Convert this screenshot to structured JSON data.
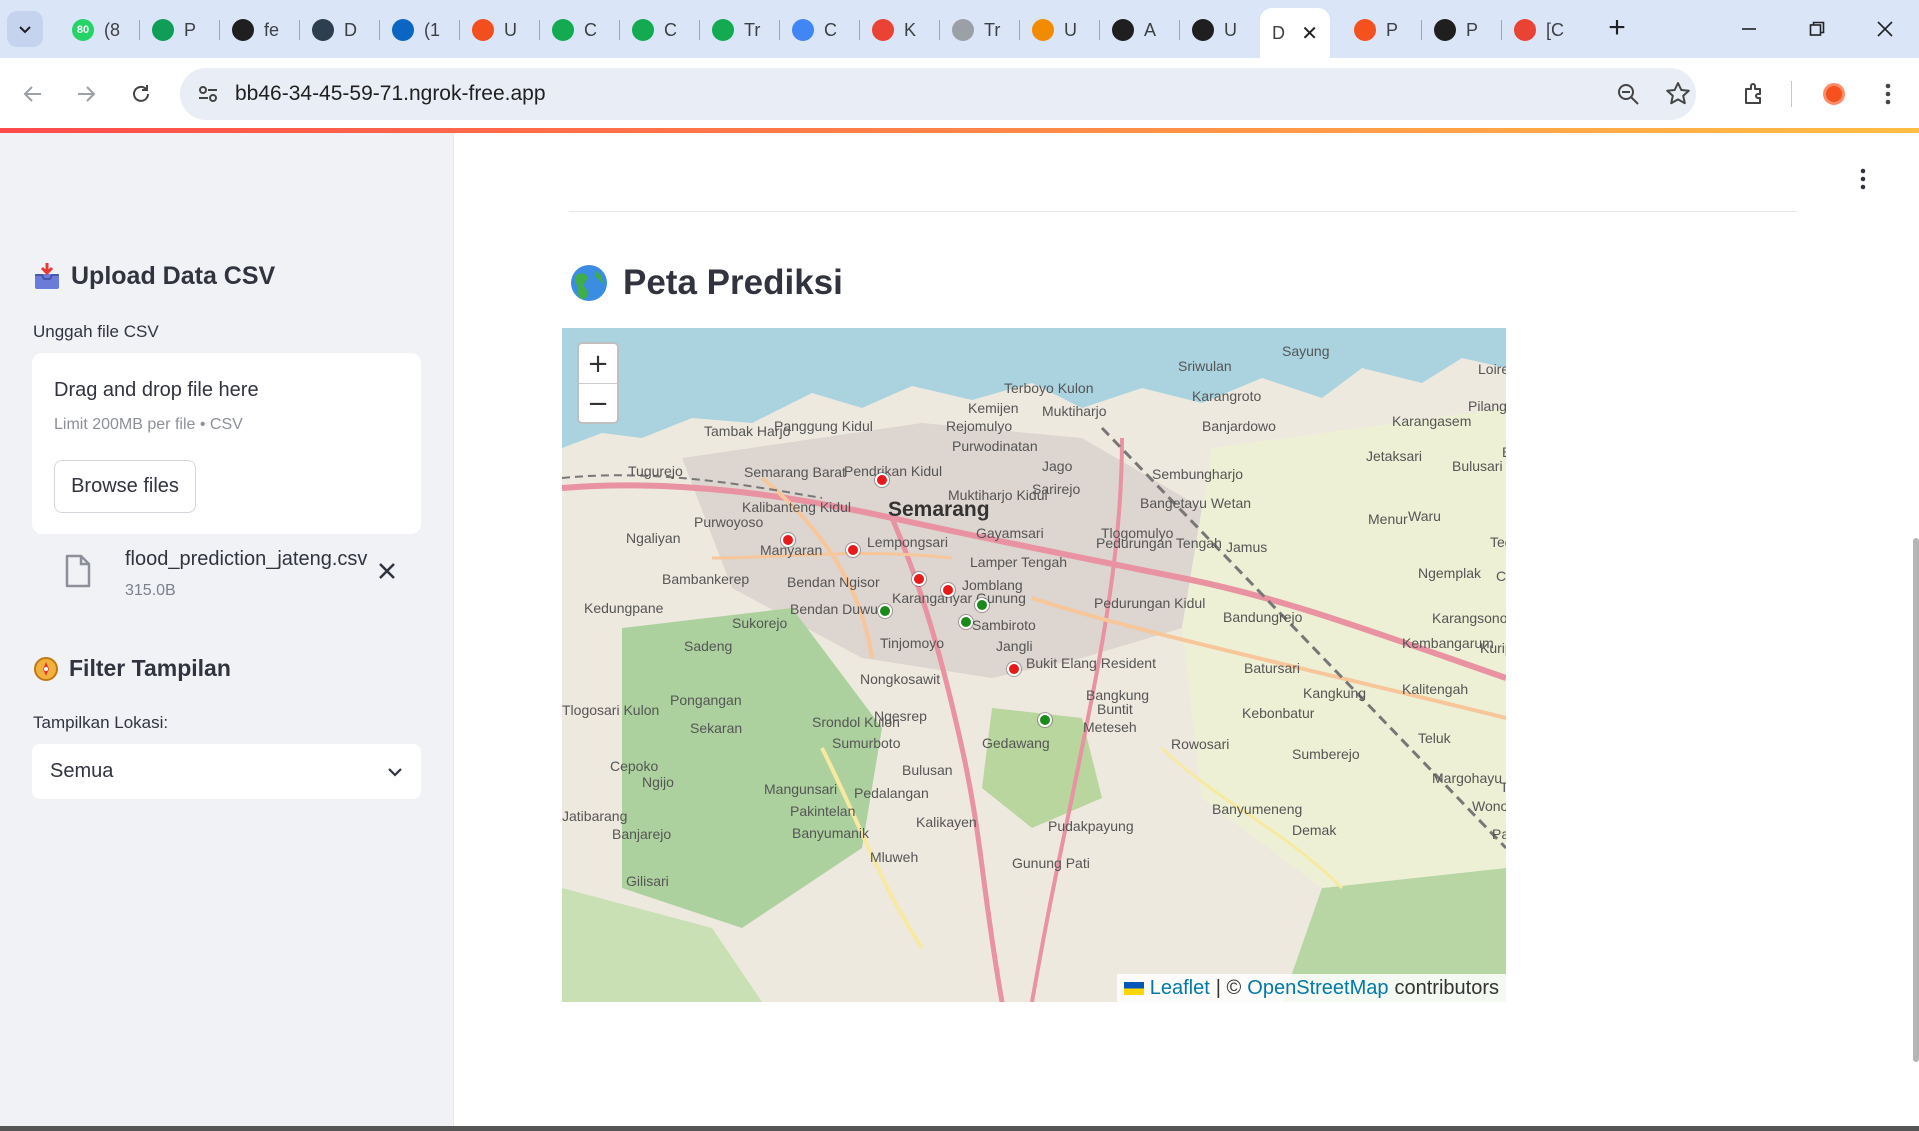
{
  "browser": {
    "tabs": [
      {
        "label": "(8",
        "icon": "whatsapp-icon",
        "color": "#25d366",
        "badge": "80"
      },
      {
        "label": "P",
        "icon": "sheets-plus-icon",
        "color": "#0f9d58"
      },
      {
        "label": "fe",
        "icon": "github-icon",
        "color": "#1f1f1f"
      },
      {
        "label": "D",
        "icon": "dicoding-icon",
        "color": "#2d3e50"
      },
      {
        "label": "(1",
        "icon": "linkedin-icon",
        "color": "#0a66c2"
      },
      {
        "label": "U",
        "icon": "figma-icon",
        "color": "#f24e1e"
      },
      {
        "label": "C",
        "icon": "mongodb-icon",
        "color": "#13aa52"
      },
      {
        "label": "C",
        "icon": "mongodb-icon",
        "color": "#13aa52"
      },
      {
        "label": "Tr",
        "icon": "mongodb-icon",
        "color": "#13aa52"
      },
      {
        "label": "C",
        "icon": "shield-icon",
        "color": "#4285f4"
      },
      {
        "label": "K",
        "icon": "gmail-icon",
        "color": "#ea4335"
      },
      {
        "label": "Tr",
        "icon": "globe-icon",
        "color": "#9aa0a6"
      },
      {
        "label": "U",
        "icon": "infinity-icon",
        "color": "#f28b00"
      },
      {
        "label": "A",
        "icon": "github-icon",
        "color": "#1f1f1f"
      },
      {
        "label": "U",
        "icon": "github-icon",
        "color": "#1f1f1f"
      },
      {
        "label": "D",
        "icon": "page-icon",
        "color": "#fff",
        "active": true
      },
      {
        "label": "P",
        "icon": "spinner-icon",
        "color": "#f4511e"
      },
      {
        "label": "P",
        "icon": "openai-icon",
        "color": "#1f1f1f"
      },
      {
        "label": "[C",
        "icon": "gmail-icon",
        "color": "#ea4335"
      }
    ],
    "url": "bb46-34-45-59-71.ngrok-free.app"
  },
  "sidebar": {
    "upload_heading": "Upload Data CSV",
    "upload_label": "Unggah file CSV",
    "dropzone_title": "Drag and drop file here",
    "dropzone_sub": "Limit 200MB per file • CSV",
    "browse_label": "Browse files",
    "file_name": "flood_prediction_jateng.csv",
    "file_size": "315.0B",
    "filter_heading": "Filter Tampilan",
    "filter_label": "Tampilkan Lokasi:",
    "filter_value": "Semua"
  },
  "main": {
    "title": "Peta Prediksi",
    "map": {
      "zoom_in": "+",
      "zoom_out": "−",
      "attribution_leaflet": "Leaflet",
      "attribution_sep": "| ©",
      "attribution_osm": "OpenStreetMap",
      "attribution_suffix": "contributors",
      "colors": {
        "flood": "#e6191b",
        "safe": "#1a8a1a"
      },
      "place_labels": [
        "Sayung",
        "Sriwulan",
        "Terboyo Kulon",
        "Kemijen",
        "Muktiharjo",
        "Panggung Kidul",
        "Purwodinatan",
        "Rejomulyo",
        "Tambak Harjo",
        "Tugurejo",
        "Semarang Barat",
        "Pendrikan Kidul",
        "Kalibanteng Kidul",
        "Purwoyoso",
        "Ngaliyan",
        "Semarang",
        "Lempongsari",
        "Gayamsari",
        "Lamper Tengah",
        "Jomblang",
        "Manyaran",
        "Bambankerep",
        "Bendan Ngisor",
        "Bendan Duwur",
        "Karanganyar Gunung",
        "Tinjomoyo",
        "Jangli",
        "Sambiroto",
        "Pedurungan Kidul",
        "Pedurungan Tengah",
        "Tlogomulyo",
        "Bangetayu Wetan",
        "Sembungharjo",
        "Karangroto",
        "Banjardowo",
        "Loireng",
        "Karangasem",
        "Pilangsari",
        "Jetaksari",
        "Bulusari",
        "Blerong",
        "Menur",
        "Waru",
        "Tegalarum",
        "Jamus",
        "Ngemplak",
        "Candisari",
        "Bandungrejo",
        "Karangsono",
        "Kembangarum",
        "Kuripan",
        "Batursari",
        "Kangkung",
        "Kalitengah",
        "Bukit Elang Resident",
        "Bangkung",
        "Buntit",
        "Meteseh",
        "Rowosari",
        "Kebonbatur",
        "Sumberejo",
        "Teluk",
        "Margohayu",
        "Wonosekar",
        "Tlogorejo",
        "Banyumeneng",
        "Demak",
        "Padan",
        "Kedungpane",
        "Sadeng",
        "Sukorejo",
        "Pongangan",
        "Sekaran",
        "Srondol Kulon",
        "Sumurboto",
        "Ngesrep",
        "Nongkosawit",
        "Cepoko",
        "Ngijo",
        "Mangunsari",
        "Pakintelan",
        "Banyumanik",
        "Pedalangan",
        "Bulusan",
        "Gedawang",
        "Kalikayen",
        "Pudakpayung",
        "Mluweh",
        "Gunung Pati",
        "Banjarejo",
        "Gilisari",
        "Jatibarang",
        "Tlogosari Kulon",
        "Sarirejo",
        "Muktiharjo Kidul",
        "Jago"
      ],
      "markers": [
        {
          "status": "flood"
        },
        {
          "status": "flood"
        },
        {
          "status": "flood"
        },
        {
          "status": "flood"
        },
        {
          "status": "flood"
        },
        {
          "status": "flood"
        },
        {
          "status": "safe"
        },
        {
          "status": "safe"
        },
        {
          "status": "safe"
        },
        {
          "status": "safe"
        }
      ]
    }
  }
}
